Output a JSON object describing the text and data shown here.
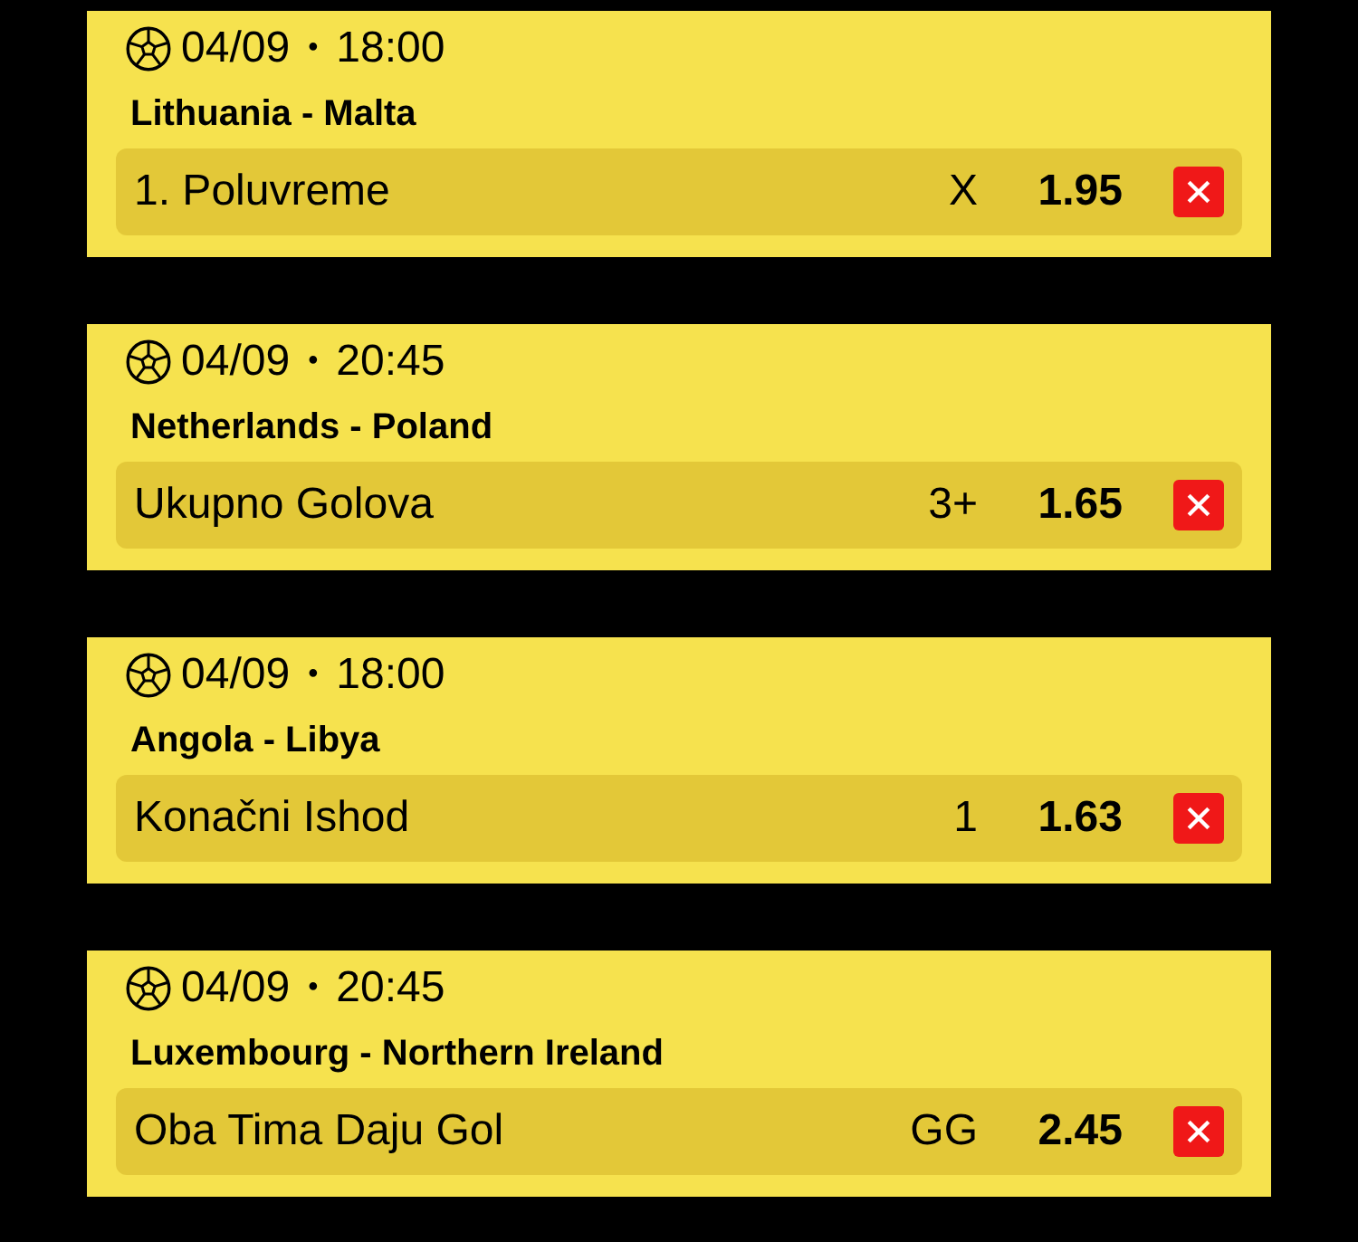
{
  "bets": [
    {
      "date": "04/09",
      "separator": "•",
      "time": "18:00",
      "match": "Lithuania - Malta",
      "market": "1. Poluvreme",
      "pick": "X",
      "odds": "1.95"
    },
    {
      "date": "04/09",
      "separator": "•",
      "time": "20:45",
      "match": "Netherlands - Poland",
      "market": "Ukupno Golova",
      "pick": "3+",
      "odds": "1.65"
    },
    {
      "date": "04/09",
      "separator": "•",
      "time": "18:00",
      "match": "Angola - Libya",
      "market": "Konačni Ishod",
      "pick": "1",
      "odds": "1.63"
    },
    {
      "date": "04/09",
      "separator": "•",
      "time": "20:45",
      "match": "Luxembourg - Northern Ireland",
      "market": "Oba Tima Daju Gol",
      "pick": "GG",
      "odds": "2.45"
    }
  ]
}
